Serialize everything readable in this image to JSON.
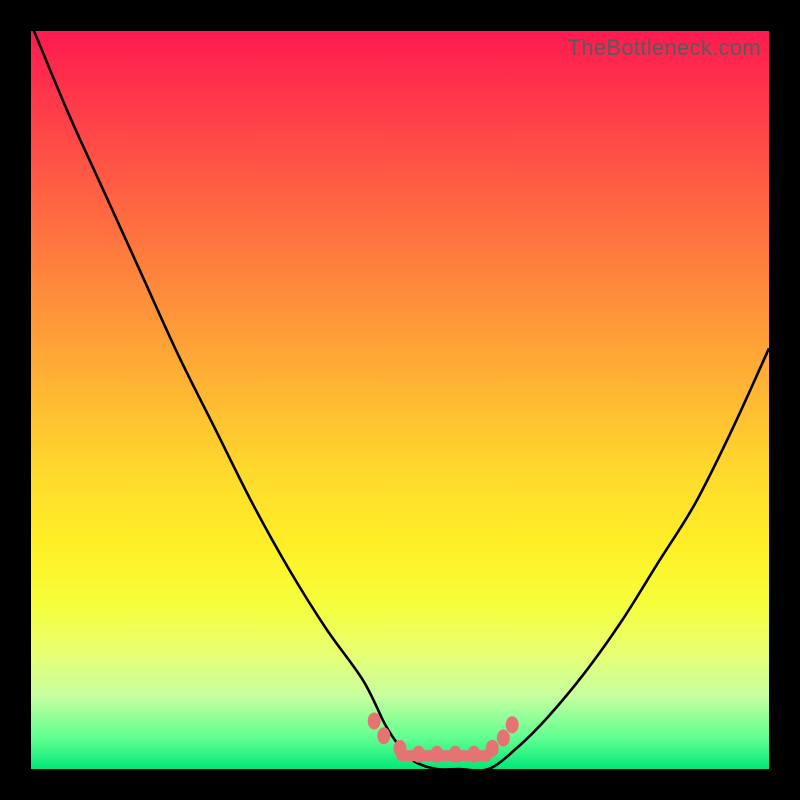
{
  "attribution": "TheBottleneck.com",
  "chart_data": {
    "type": "line",
    "title": "",
    "xlabel": "",
    "ylabel": "",
    "xlim": [
      0,
      100
    ],
    "ylim": [
      0,
      100
    ],
    "series": [
      {
        "name": "bottleneck-curve",
        "x": [
          0,
          5,
          10,
          15,
          20,
          25,
          30,
          35,
          40,
          45,
          48,
          50,
          52,
          55,
          58,
          62,
          66,
          70,
          75,
          80,
          85,
          90,
          95,
          100
        ],
        "values": [
          101,
          89,
          78,
          67,
          56,
          46,
          36,
          27,
          19,
          12,
          6,
          3,
          1,
          0,
          0,
          0,
          3,
          7,
          13,
          20,
          28,
          36,
          46,
          57
        ]
      },
      {
        "name": "marker-dots",
        "x": [
          46.5,
          47.8,
          50.0,
          52.5,
          55.0,
          57.5,
          60.0,
          62.5,
          64.0,
          65.2
        ],
        "values": [
          6.5,
          4.5,
          2.8,
          2.0,
          2.0,
          2.0,
          2.0,
          2.8,
          4.2,
          6.0
        ]
      },
      {
        "name": "bottom-bar",
        "x": [
          49.5,
          62.5
        ],
        "values": [
          1.8,
          1.8
        ]
      }
    ]
  },
  "colors": {
    "frame": "#000000",
    "curve": "#000000",
    "markers": "#e57373",
    "attribution": "#5a5a5a"
  }
}
